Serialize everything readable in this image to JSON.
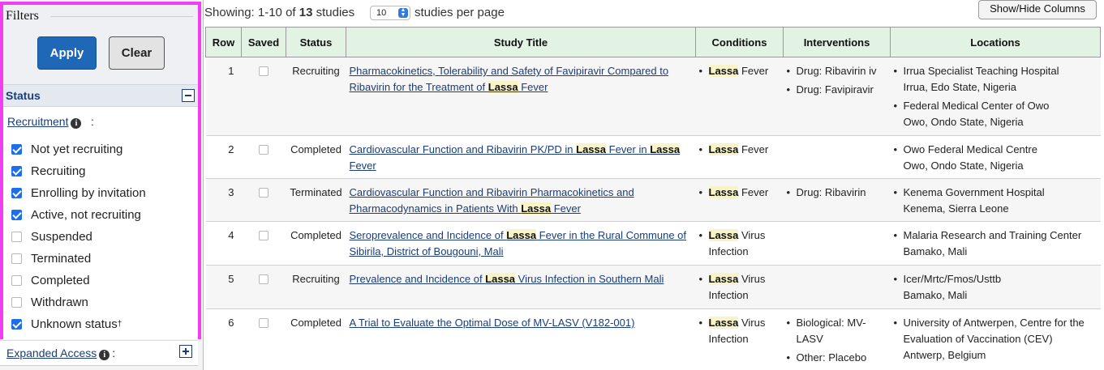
{
  "filters": {
    "legend": "Filters",
    "apply_label": "Apply",
    "clear_label": "Clear",
    "status_title": "Status",
    "recruitment_label": "Recruitment",
    "recruitment_info_glyph": "i",
    "recruitment_colon": ":",
    "recruitment_options": [
      {
        "label": "Not yet recruiting",
        "checked": true
      },
      {
        "label": "Recruiting",
        "checked": true
      },
      {
        "label": "Enrolling by invitation",
        "checked": true
      },
      {
        "label": "Active, not recruiting",
        "checked": true
      },
      {
        "label": "Suspended",
        "checked": false
      },
      {
        "label": "Terminated",
        "checked": false
      },
      {
        "label": "Completed",
        "checked": false
      },
      {
        "label": "Withdrawn",
        "checked": false
      },
      {
        "label": "Unknown status",
        "sup": "†",
        "checked": true
      }
    ],
    "expanded_access_label": "Expanded Access",
    "expanded_access_info_glyph": "i",
    "expanded_access_colon": ":",
    "accent_color": "#1f67b7",
    "highlight_border_color": "#f03ef0"
  },
  "results_header": {
    "showing_prefix": "Showing: 1-10 of ",
    "total": "13",
    "showing_suffix": " studies",
    "per_page_value": "10",
    "per_page_text": "studies per page",
    "show_hide_columns": "Show/Hide Columns"
  },
  "table": {
    "columns": [
      "Row",
      "Saved",
      "Status",
      "Study Title",
      "Conditions",
      "Interventions",
      "Locations"
    ],
    "rows": [
      {
        "row": "1",
        "status": "Recruiting",
        "status_class": "st-recruiting",
        "title_parts": [
          [
            "Pharmacokinetics, Tolerability and Safety of Favipiravir Compared to Ribavirin for the Treatment of ",
            false
          ],
          [
            "Lassa",
            true
          ],
          [
            " Fever",
            false
          ]
        ],
        "conditions": [
          [
            [
              "Lassa",
              true
            ],
            [
              " Fever",
              false
            ]
          ]
        ],
        "interventions": [
          "Drug: Ribavirin iv",
          "Drug: Favipiravir"
        ],
        "locations": [
          [
            "Irrua Specialist Teaching Hospital",
            "Irrua, Edo State, Nigeria"
          ],
          [
            "Federal Medical Center of Owo",
            "Owo, Ondo State, Nigeria"
          ]
        ]
      },
      {
        "row": "2",
        "status": "Completed",
        "status_class": "st-completed",
        "title_parts": [
          [
            "Cardiovascular Function and Ribavirin PK/PD in ",
            false
          ],
          [
            "Lassa",
            true
          ],
          [
            " Fever in ",
            false
          ],
          [
            "Lassa",
            true
          ],
          [
            " Fever",
            false
          ]
        ],
        "conditions": [
          [
            [
              "Lassa",
              true
            ],
            [
              " Fever",
              false
            ]
          ]
        ],
        "interventions": [],
        "locations": [
          [
            "Owo Federal Medical Centre",
            "Owo, Ondo State, Nigeria"
          ]
        ]
      },
      {
        "row": "3",
        "status": "Terminated",
        "status_class": "st-terminated",
        "title_parts": [
          [
            "Cardiovascular Function and Ribavirin Pharmacokinetics and Pharmacodynamics in Patients With ",
            false
          ],
          [
            "Lassa",
            true
          ],
          [
            " Fever",
            false
          ]
        ],
        "conditions": [
          [
            [
              "Lassa",
              true
            ],
            [
              " Fever",
              false
            ]
          ]
        ],
        "interventions": [
          "Drug: Ribavirin"
        ],
        "locations": [
          [
            "Kenema Government Hospital",
            "Kenema, Sierra Leone"
          ]
        ]
      },
      {
        "row": "4",
        "status": "Completed",
        "status_class": "st-completed",
        "title_parts": [
          [
            "Seroprevalence and Incidence of ",
            false
          ],
          [
            "Lassa",
            true
          ],
          [
            " Fever in the Rural Commune of Sibirila, District of Bougouni, Mali",
            false
          ]
        ],
        "conditions": [
          [
            [
              "Lassa",
              true
            ],
            [
              " Virus Infection",
              false
            ]
          ]
        ],
        "interventions": [],
        "locations": [
          [
            "Malaria Research and Training Center",
            "Bamako, Mali"
          ]
        ]
      },
      {
        "row": "5",
        "status": "Recruiting",
        "status_class": "st-recruiting",
        "title_parts": [
          [
            "Prevalence and Incidence of ",
            false
          ],
          [
            "Lassa",
            true
          ],
          [
            " Virus Infection in Southern Mali",
            false
          ]
        ],
        "conditions": [
          [
            [
              "Lassa",
              true
            ],
            [
              " Virus Infection",
              false
            ]
          ]
        ],
        "interventions": [],
        "locations": [
          [
            "Icer/Mrtc/Fmos/Usttb",
            "Bamako, Mali"
          ]
        ]
      },
      {
        "row": "6",
        "status": "Completed",
        "status_class": "st-completed",
        "title_parts": [
          [
            "A Trial to Evaluate the Optimal Dose of MV-LASV (V182-001)",
            false
          ]
        ],
        "conditions": [
          [
            [
              "Lassa",
              true
            ],
            [
              " Virus Infection",
              false
            ]
          ]
        ],
        "interventions": [
          "Biological: MV-LASV",
          "Other: Placebo"
        ],
        "locations": [
          [
            "University of Antwerpen, Centre for the Evaluation of Vaccination (CEV)",
            "Antwerp, Belgium"
          ]
        ]
      }
    ]
  }
}
